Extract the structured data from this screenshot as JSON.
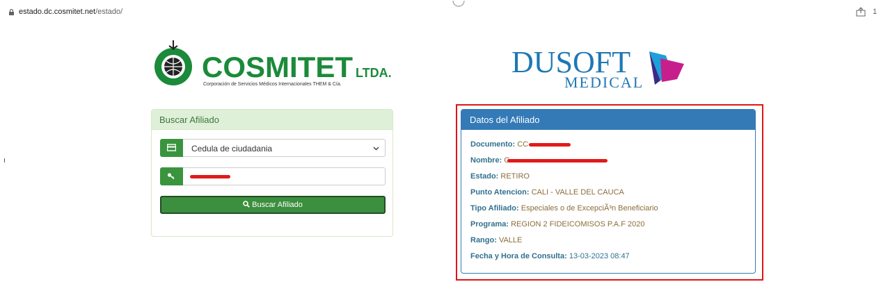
{
  "browser": {
    "url_host": "estado.dc.cosmitet.net",
    "url_path": "/estado/",
    "extra_text": "1"
  },
  "logos": {
    "cosmitet_name": "COSMITET",
    "cosmitet_suffix": "LTDA.",
    "cosmitet_tagline": "Corporación de Servicios Médicos Internacionales THEM & Cía.",
    "dusoft_name": "DUSOFT",
    "dusoft_sub": "MEDICAL"
  },
  "search_panel": {
    "title": "Buscar Afiliado",
    "doc_type_value": "Cedula de ciudadania",
    "search_button_label": "Buscar Afiliado"
  },
  "affiliate_panel": {
    "title": "Datos del Afiliado",
    "fields": [
      {
        "label": "Documento:",
        "value": "CC"
      },
      {
        "label": "Nombre:",
        "value": "G"
      },
      {
        "label": "Estado:",
        "value": "RETIRO"
      },
      {
        "label": "Punto Atencion:",
        "value": "CALI - VALLE DEL CAUCA"
      },
      {
        "label": "Tipo Afiliado:",
        "value": "Especiales o de ExcepciÃ³n Beneficiario"
      },
      {
        "label": "Programa:",
        "value": "REGION 2 FIDEICOMISOS P.A.F 2020"
      },
      {
        "label": "Rango:",
        "value": "VALLE"
      },
      {
        "label": "Fecha y Hora de Consulta:",
        "value": "13-03-2023 08:47"
      }
    ]
  },
  "colors": {
    "success_green": "#3a943e",
    "primary_blue": "#337ab7",
    "highlight_red": "#e01414"
  },
  "icons": [
    "lock-icon",
    "share-icon",
    "card-icon",
    "key-icon",
    "search-icon",
    "chevron-down-icon"
  ]
}
